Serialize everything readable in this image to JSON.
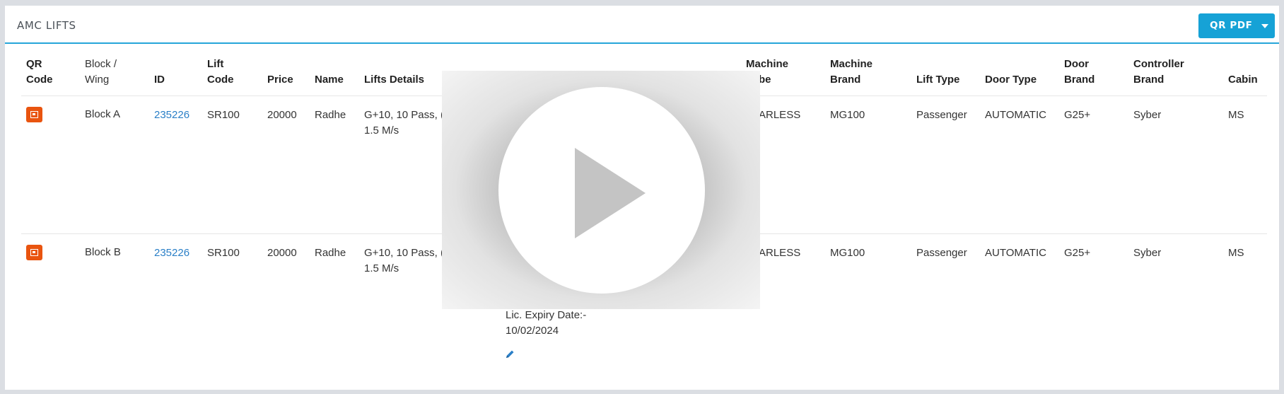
{
  "panel": {
    "title": "AMC LIFTS"
  },
  "toolbar": {
    "qr_pdf_label": "QR PDF",
    "caret_icon": "caret-down-icon"
  },
  "table": {
    "headers": {
      "qr": [
        "QR",
        "Code"
      ],
      "block": [
        "Block /",
        "Wing"
      ],
      "id": "ID",
      "lift_code": [
        "Lift",
        "Code"
      ],
      "price": "Price",
      "name": "Name",
      "lift_details": "Lifts Details",
      "machine_type": [
        "Machine",
        "be"
      ],
      "machine_brand": [
        "Machine",
        "Brand"
      ],
      "lift_type": "Lift Type",
      "door_type": "Door Type",
      "door_brand": [
        "Door",
        "Brand"
      ],
      "controller_brand": [
        "Controller",
        "Brand"
      ],
      "cabin": "Cabin"
    },
    "rows": [
      {
        "block": "Block A",
        "id": "235226",
        "lift_code": "SR100",
        "price": "20000",
        "name": "Radhe",
        "details": [
          "G+10, 10 Pass, (",
          "1.5 M/s"
        ],
        "machine_type": "EARLESS",
        "machine_brand": "MG100",
        "lift_type": "Passenger",
        "door_type": "AUTOMATIC",
        "door_brand": "G25+",
        "controller_brand": "Syber",
        "cabin": "MS"
      },
      {
        "block": "Block B",
        "id": "235226",
        "lift_code": "SR100",
        "price": "20000",
        "name": "Radhe",
        "details": [
          "G+10, 10 Pass, (",
          "1.5 M/s"
        ],
        "machine_type": "EARLESS",
        "machine_brand": "MG100",
        "lift_type": "Passenger",
        "door_type": "AUTOMATIC",
        "door_brand": "G25+",
        "controller_brand": "Syber",
        "cabin": "MS",
        "license": [
          "Lic. Expiry Date:-",
          "10/02/2024"
        ]
      }
    ]
  },
  "video": {
    "play_icon": "play-icon"
  },
  "colors": {
    "accent": "#16a2d6",
    "qr_icon": "#e9540f",
    "link": "#2a7fc7"
  }
}
